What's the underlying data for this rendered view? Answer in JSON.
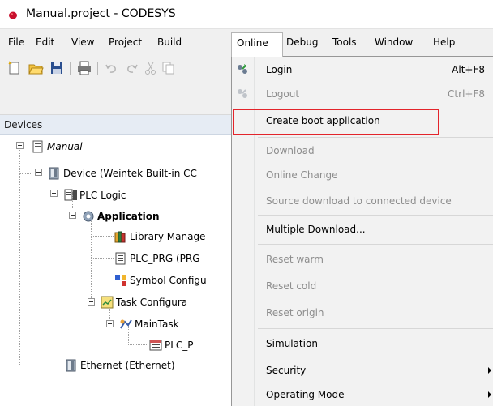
{
  "window": {
    "title": "Manual.project - CODESYS"
  },
  "menubar": {
    "items": [
      {
        "label": "File"
      },
      {
        "label": "Edit"
      },
      {
        "label": "View"
      },
      {
        "label": "Project"
      },
      {
        "label": "Build"
      },
      {
        "label": "Online"
      },
      {
        "label": "Debug"
      },
      {
        "label": "Tools"
      },
      {
        "label": "Window"
      },
      {
        "label": "Help"
      }
    ]
  },
  "devices": {
    "header": "Devices",
    "tree": [
      {
        "label": "Manual"
      },
      {
        "label": "Device (Weintek Built-in CC"
      },
      {
        "label": "PLC Logic"
      },
      {
        "label": "Application"
      },
      {
        "label": "Library Manage"
      },
      {
        "label": "PLC_PRG (PRG"
      },
      {
        "label": "Symbol Configu"
      },
      {
        "label": "Task Configura"
      },
      {
        "label": "MainTask"
      },
      {
        "label": "PLC_P"
      },
      {
        "label": "Ethernet (Ethernet)"
      }
    ]
  },
  "online_menu": {
    "items": [
      {
        "label": "Login",
        "shortcut": "Alt+F8",
        "enabled": true,
        "icon": "login-icon"
      },
      {
        "label": "Logout",
        "shortcut": "Ctrl+F8",
        "enabled": false,
        "icon": "logout-icon"
      },
      {
        "label": "Create boot application",
        "shortcut": "",
        "enabled": true,
        "highlighted": true
      },
      {
        "label": "Download",
        "shortcut": "",
        "enabled": false
      },
      {
        "label": "Online Change",
        "shortcut": "",
        "enabled": false
      },
      {
        "label": "Source download to connected device",
        "shortcut": "",
        "enabled": false
      },
      {
        "label": "Multiple Download...",
        "shortcut": "",
        "enabled": true
      },
      {
        "label": "Reset warm",
        "shortcut": "",
        "enabled": false
      },
      {
        "label": "Reset cold",
        "shortcut": "",
        "enabled": false
      },
      {
        "label": "Reset origin",
        "shortcut": "",
        "enabled": false
      },
      {
        "label": "Simulation",
        "shortcut": "",
        "enabled": true
      },
      {
        "label": "Security",
        "shortcut": "",
        "enabled": true,
        "submenu": true
      },
      {
        "label": "Operating Mode",
        "shortcut": "",
        "enabled": true,
        "submenu": true
      }
    ]
  },
  "colors": {
    "highlight_border": "#e3242b",
    "disabled_text": "#8d8d8d",
    "panel_header": "#e6ecf4"
  }
}
